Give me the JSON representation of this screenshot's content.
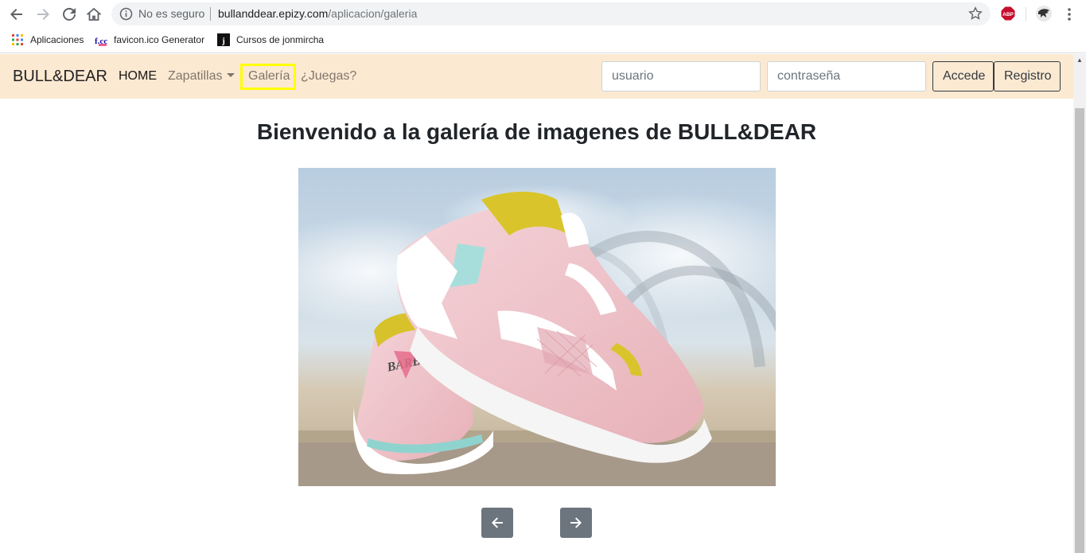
{
  "browser": {
    "security_label": "No es seguro",
    "url_host": "bullanddear.epizy.com",
    "url_path": "/aplicacion/galeria",
    "extension_abp": "ABP",
    "bookmarks": [
      {
        "label": "Aplicaciones"
      },
      {
        "label": "favicon.ico Generator",
        "icon_text": "f.cc"
      },
      {
        "label": "Cursos de jonmircha",
        "icon_text": "j"
      }
    ]
  },
  "navbar": {
    "brand": "BULL&DEAR",
    "links": [
      {
        "label": "HOME"
      },
      {
        "label": "Zapatillas"
      },
      {
        "label": "Galería"
      },
      {
        "label": "¿Juegas?"
      }
    ],
    "user_placeholder": "usuario",
    "password_placeholder": "contraseña",
    "login_button": "Accede",
    "register_button": "Registro"
  },
  "main": {
    "title": "Bienvenido a la galería de imagenes de BULL&DEAR",
    "image_text": "BARBIE",
    "prev_icon": "arrow-left-icon",
    "next_icon": "arrow-right-icon"
  },
  "colors": {
    "navbar_bg": "#fbe9d2",
    "highlight_border": "#ffff00",
    "arrow_button_bg": "#6c757d"
  }
}
